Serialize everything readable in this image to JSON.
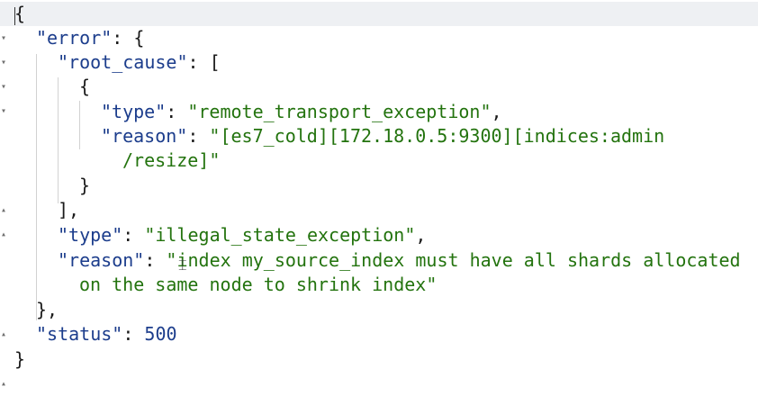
{
  "colors": {
    "key": "#1c3d8c",
    "string": "#23730e",
    "number": "#1c3d8c",
    "active_line": "#eef0f3",
    "indent_guide": "#d2d2d2"
  },
  "json_response": {
    "open_brace": "{",
    "close_brace": "}",
    "error_key": "\"error\"",
    "error_open": ": {",
    "root_cause_key": "\"root_cause\"",
    "root_cause_open": ": [",
    "item_open": "{",
    "rc_type_key": "\"type\"",
    "rc_type_value": "\"remote_transport_exception\"",
    "rc_type_comma": ",",
    "rc_reason_key": "\"reason\"",
    "rc_reason_value_line1": "\"[es7_cold][172.18.0.5:9300][indices:admin",
    "rc_reason_value_line2": "/resize]\"",
    "item_close": "}",
    "root_cause_close": "],",
    "type_key": "\"type\"",
    "type_value": "\"illegal_state_exception\"",
    "type_comma": ",",
    "reason_key": "\"reason\"",
    "reason_value_line1": "\"index my_source_index must have all shards allocated",
    "reason_value_line2": "on the same node to shrink index\"",
    "error_close": "},",
    "status_key": "\"status\"",
    "status_value": "500"
  },
  "gutter_icons": [
    "fold-arrow-icon"
  ]
}
